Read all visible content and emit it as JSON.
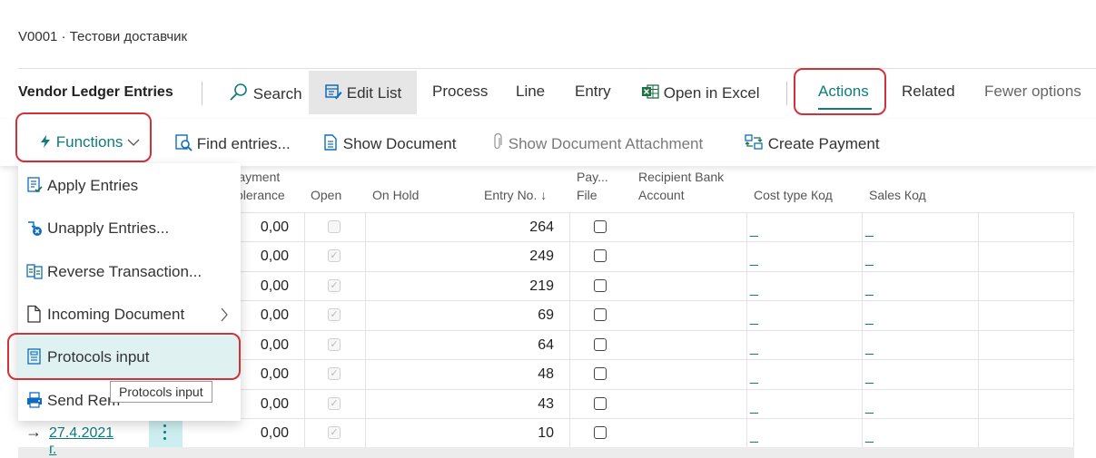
{
  "breadcrumb": "V0001 · Тестови доставчик",
  "page_title": "Vendor Ledger Entries",
  "toolbar": {
    "search": "Search",
    "edit_list": "Edit List",
    "process": "Process",
    "line": "Line",
    "entry": "Entry",
    "open_in_excel": "Open in Excel",
    "actions": "Actions",
    "related": "Related",
    "fewer_options": "Fewer options"
  },
  "subbar": {
    "functions": "Functions",
    "find_entries": "Find entries...",
    "show_document": "Show Document",
    "show_attachment": "Show Document Attachment",
    "create_payment": "Create Payment"
  },
  "menu": {
    "items": [
      {
        "label": "Apply Entries",
        "icon": "apply-entries-icon"
      },
      {
        "label": "Unapply Entries...",
        "icon": "unapply-entries-icon"
      },
      {
        "label": "Reverse Transaction...",
        "icon": "reverse-transaction-icon"
      },
      {
        "label": "Incoming Document",
        "icon": "document-icon"
      },
      {
        "label": "Protocols input",
        "icon": "protocol-icon"
      },
      {
        "label": "Send Rem",
        "icon": "send-reminder-icon"
      }
    ],
    "tooltip": "Protocols input"
  },
  "table": {
    "headers": {
      "payment_tolerance_1": "Payment",
      "payment_tolerance_2": "Tolerance",
      "open": "Open",
      "on_hold": "On Hold",
      "entry_no": "Entry No. ↓",
      "pay_file_1": "Pay...",
      "pay_file_2": "File",
      "recipient_1": "Recipient Bank",
      "recipient_2": "Account",
      "cost_type": "Cost type Код",
      "sales": "Sales Код"
    },
    "rows": [
      {
        "tolerance": "0,00",
        "open": false,
        "entry_no": "264"
      },
      {
        "tolerance": "0,00",
        "open": true,
        "entry_no": "249"
      },
      {
        "tolerance": "0,00",
        "open": true,
        "entry_no": "219"
      },
      {
        "tolerance": "0,00",
        "open": true,
        "entry_no": "69"
      },
      {
        "tolerance": "0,00",
        "open": true,
        "entry_no": "64"
      },
      {
        "tolerance": "0,00",
        "open": true,
        "entry_no": "48"
      },
      {
        "tolerance": "0,00",
        "open": true,
        "entry_no": "43"
      },
      {
        "tolerance": "0,00",
        "open": true,
        "entry_no": "10"
      }
    ],
    "last_row_date": "27.4.2021 г.",
    "dash": "_"
  },
  "colors": {
    "accent": "#0f7b7b",
    "highlight_outline": "#d0323a",
    "menu_active_bg": "#dff1f1"
  }
}
